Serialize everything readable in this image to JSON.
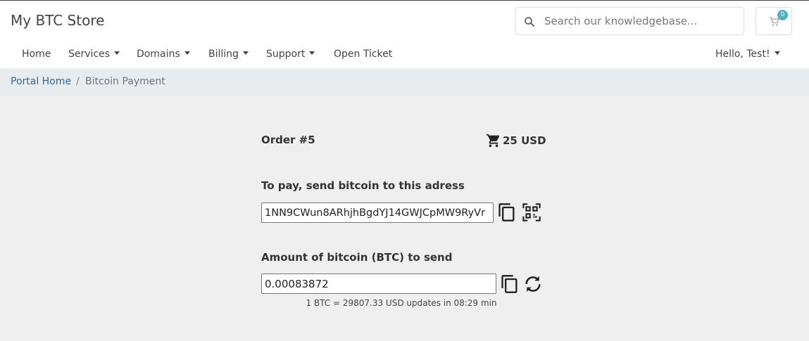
{
  "header": {
    "brand": "My BTC Store",
    "search_placeholder": "Search our knowledgebase...",
    "cart_count": "0"
  },
  "nav": {
    "home": "Home",
    "services": "Services",
    "domains": "Domains",
    "billing": "Billing",
    "support": "Support",
    "open_ticket": "Open Ticket",
    "account": "Hello, Test!"
  },
  "breadcrumb": {
    "home": "Portal Home",
    "separator": "/",
    "current": "Bitcoin Payment"
  },
  "payment": {
    "order": "Order #5",
    "total": "25 USD",
    "address_label": "To pay, send bitcoin to this adress",
    "address": "1NN9CWun8ARhjhBgdYJ14GWJCpMW9RyVr",
    "amount_label": "Amount of bitcoin (BTC) to send",
    "amount": "0.00083872",
    "rate_text": "1 BTC = 29807.33 USD updates in 08:29 min"
  },
  "icons": {
    "search": "search-icon",
    "cart": "cart-icon",
    "copy": "copy-icon",
    "qr": "qr-code-icon",
    "refresh": "refresh-icon"
  },
  "colors": {
    "link": "#336699",
    "badge": "#4fb0c6",
    "breadcrumb_bg": "#e8ecef",
    "page_bg": "#efefef"
  }
}
